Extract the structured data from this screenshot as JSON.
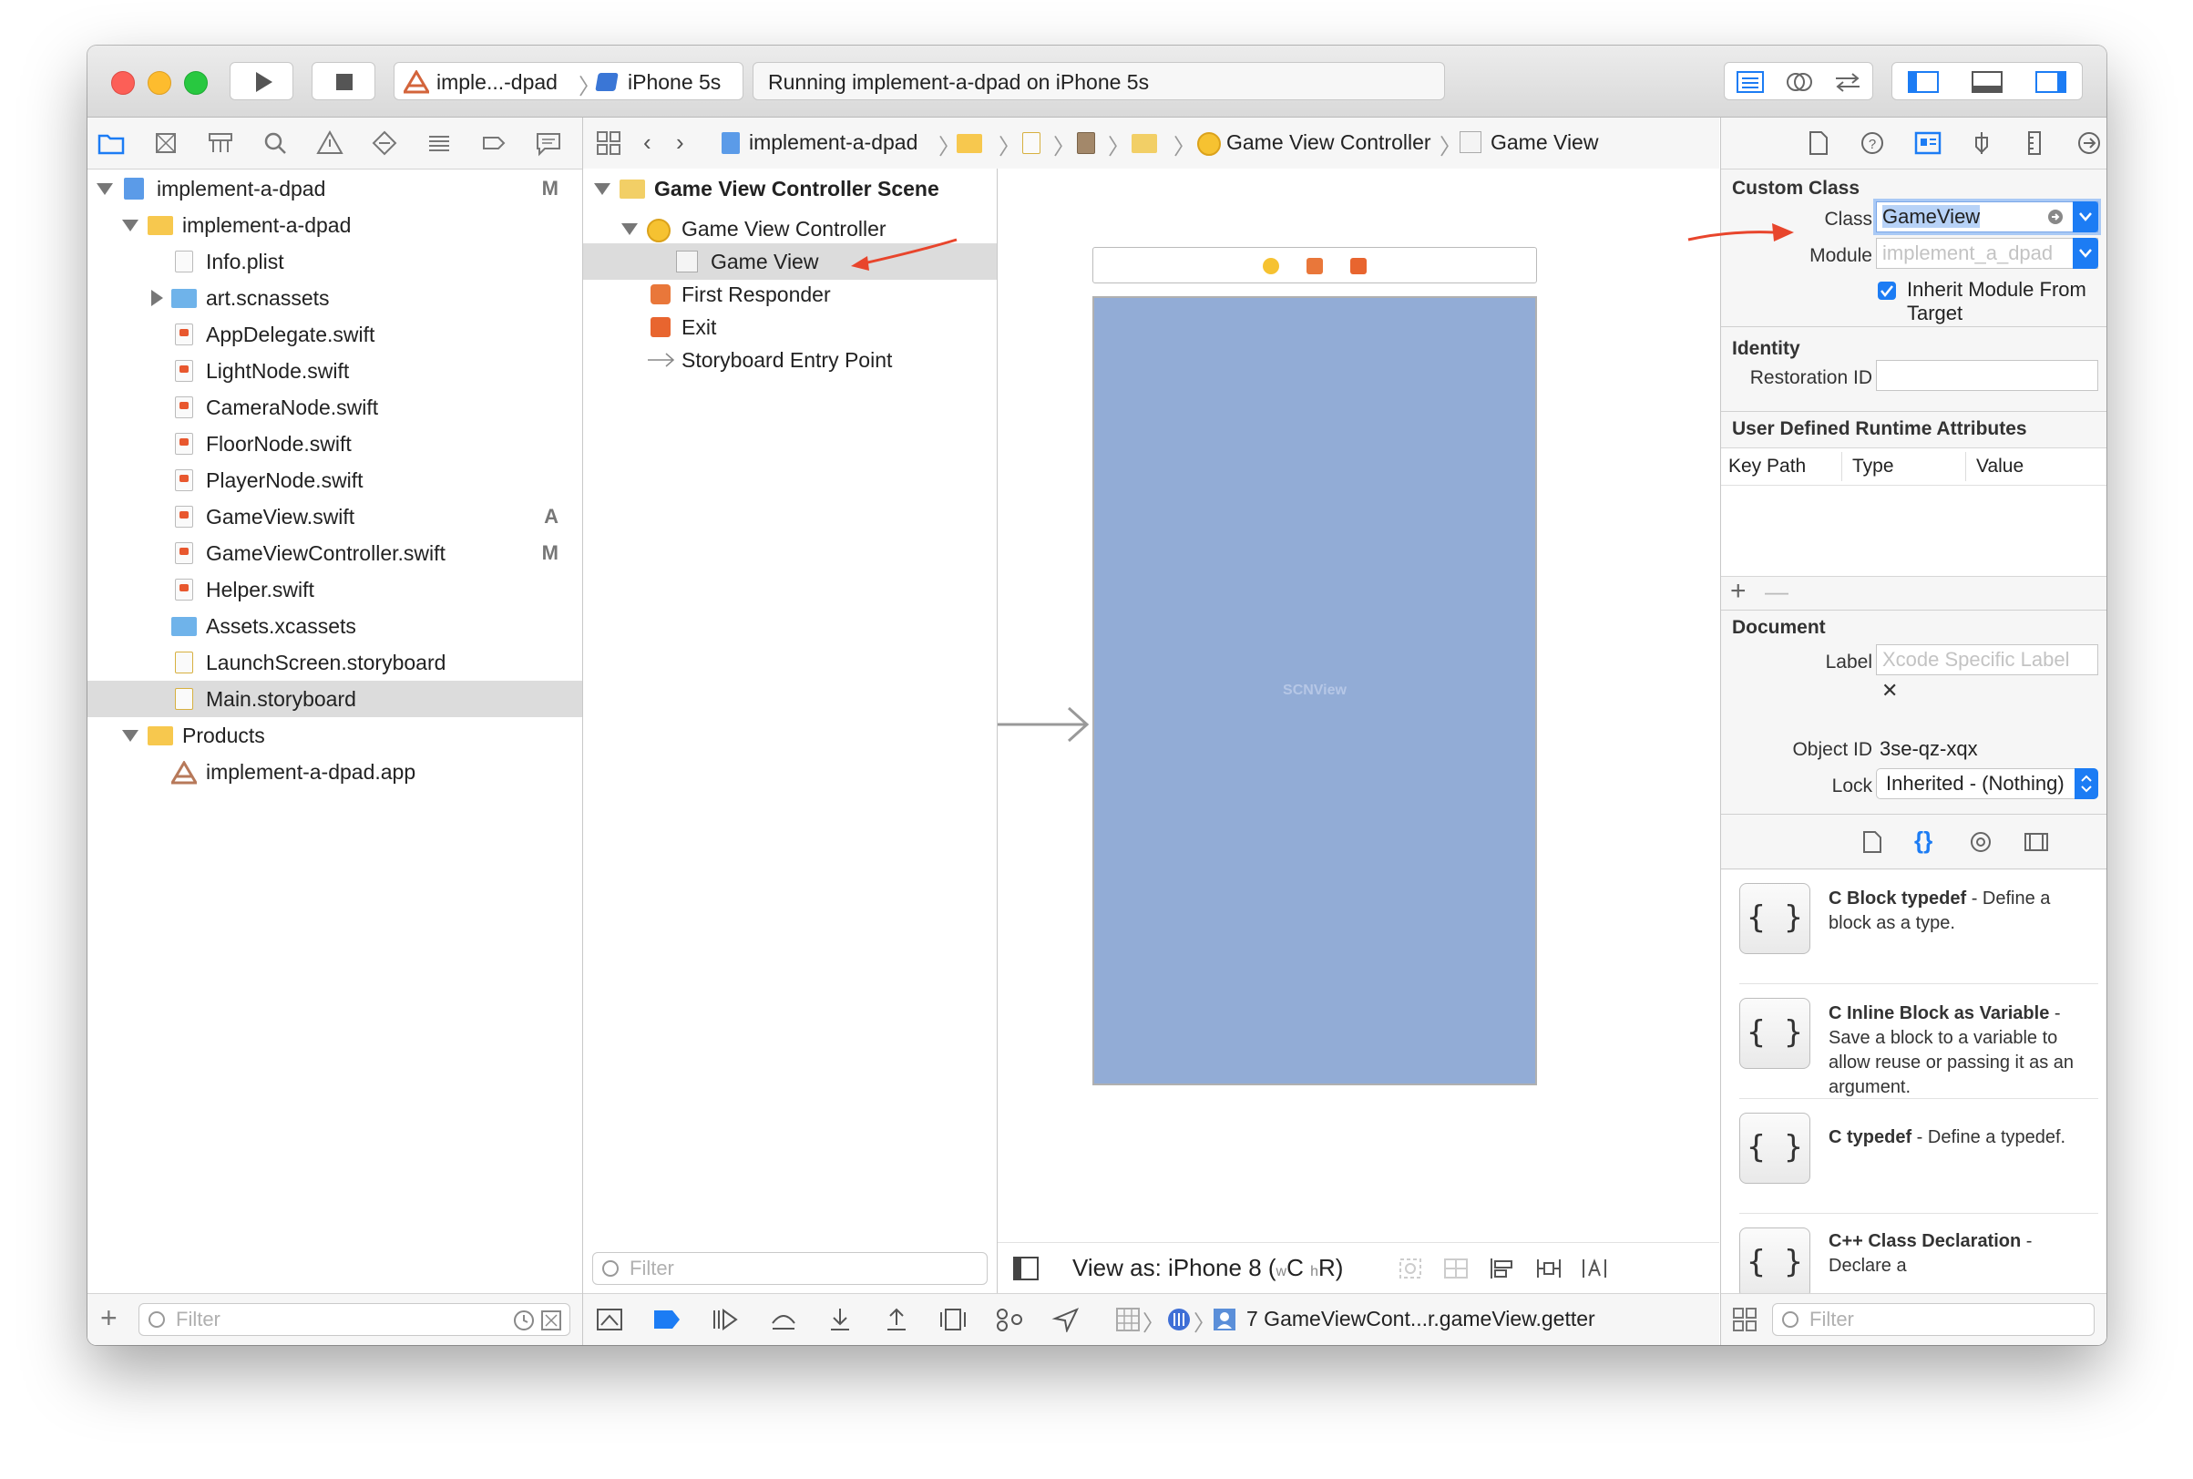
{
  "toolbar": {
    "scheme": "imple...-dpad",
    "device": "iPhone 5s",
    "status": "Running implement-a-dpad on iPhone 5s"
  },
  "navigator": {
    "items": [
      {
        "label": "implement-a-dpad",
        "badge": "M"
      },
      {
        "label": "implement-a-dpad",
        "badge": ""
      },
      {
        "label": "Info.plist",
        "badge": ""
      },
      {
        "label": "art.scnassets",
        "badge": ""
      },
      {
        "label": "AppDelegate.swift",
        "badge": ""
      },
      {
        "label": "LightNode.swift",
        "badge": ""
      },
      {
        "label": "CameraNode.swift",
        "badge": ""
      },
      {
        "label": "FloorNode.swift",
        "badge": ""
      },
      {
        "label": "PlayerNode.swift",
        "badge": ""
      },
      {
        "label": "GameView.swift",
        "badge": "A"
      },
      {
        "label": "GameViewController.swift",
        "badge": "M"
      },
      {
        "label": "Helper.swift",
        "badge": ""
      },
      {
        "label": "Assets.xcassets",
        "badge": ""
      },
      {
        "label": "LaunchScreen.storyboard",
        "badge": ""
      },
      {
        "label": "Main.storyboard",
        "badge": ""
      },
      {
        "label": "Products",
        "badge": ""
      },
      {
        "label": "implement-a-dpad.app",
        "badge": ""
      }
    ],
    "filter_placeholder": "Filter"
  },
  "jumpbar": {
    "project": "implement-a-dpad",
    "controller": "Game View Controller",
    "view": "Game View"
  },
  "outline": {
    "scene": "Game View Controller Scene",
    "controller": "Game View Controller",
    "view": "Game View",
    "responder": "First Responder",
    "exit": "Exit",
    "entry": "Storyboard Entry Point",
    "filter_placeholder": "Filter"
  },
  "canvas": {
    "view_label": "SCNView",
    "view_as": "View as: iPhone 8 (",
    "size_class_w": "w",
    "size_class_c": "C",
    "size_class_h": "h",
    "size_class_r": "R)",
    "view_color": "#92acd6"
  },
  "debugbar": {
    "frame": "7 GameViewCont...r.gameView.getter"
  },
  "inspector": {
    "custom_class_title": "Custom Class",
    "class_label": "Class",
    "class_value": "GameView",
    "module_label": "Module",
    "module_placeholder": "implement_a_dpad",
    "inherit_label": "Inherit Module From Target",
    "identity_title": "Identity",
    "restoration_label": "Restoration ID",
    "udra_title": "User Defined Runtime Attributes",
    "col_keypath": "Key Path",
    "col_type": "Type",
    "col_value": "Value",
    "document_title": "Document",
    "doc_label_label": "Label",
    "doc_label_placeholder": "Xcode Specific Label",
    "object_id_label": "Object ID",
    "object_id_value": "3se-qz-xqx",
    "lock_label": "Lock",
    "lock_value": "Inherited - (Nothing)"
  },
  "library": {
    "items": [
      {
        "title": "C Block typedef",
        "desc": " - Define a block as a type."
      },
      {
        "title": "C Inline Block as Variable",
        "desc": " - Save a block to a variable to allow reuse or passing it as an argument."
      },
      {
        "title": "C typedef",
        "desc": " - Define a typedef."
      },
      {
        "title": "C++ Class Declaration",
        "desc": " - Declare a"
      }
    ],
    "filter_placeholder": "Filter"
  },
  "colors": {
    "accent": "#1c7cf4",
    "annotation_arrow": "#e8452c"
  }
}
